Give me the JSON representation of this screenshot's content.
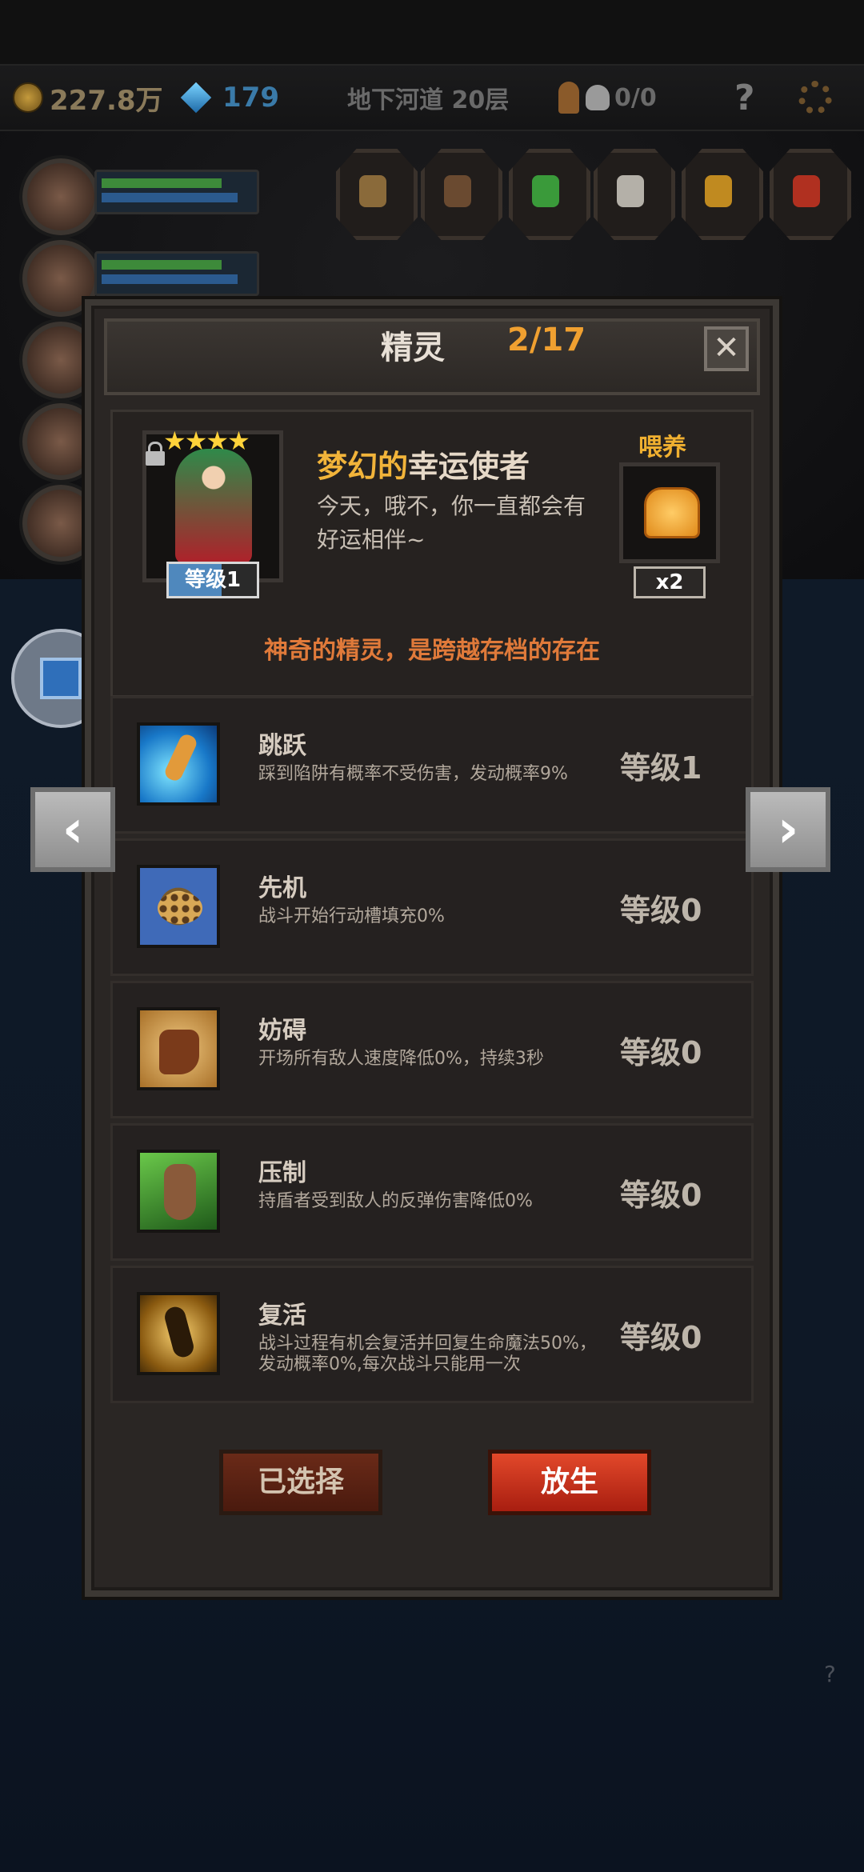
{
  "topbar": {
    "gold": "227.8万",
    "gems": "179",
    "location": "地下河道 20层",
    "keys": "0/0",
    "help": "?"
  },
  "dialog": {
    "title": "精灵",
    "count": "2/17",
    "close": "✕"
  },
  "spirit": {
    "stars": "★★★★",
    "level": "等级1",
    "name_quality": "梦幻的",
    "name": "幸运使者",
    "description": "今天，哦不，你一直都会有好运相伴~",
    "feed_label": "喂养",
    "feed_count": "x2",
    "tagline": "神奇的精灵，是跨越存档的存在"
  },
  "skills": [
    {
      "name": "跳跃",
      "desc": "踩到陷阱有概率不受伤害，发动概率9%",
      "level": "等级1",
      "icon": "jump-icon"
    },
    {
      "name": "先机",
      "desc": "战斗开始行动槽填充0%",
      "level": "等级0",
      "icon": "leopard-icon"
    },
    {
      "name": "妨碍",
      "desc": "开场所有敌人速度降低0%，持续3秒",
      "level": "等级0",
      "icon": "chained-boot-icon"
    },
    {
      "name": "压制",
      "desc": "持盾者受到敌人的反弹伤害降低0%",
      "level": "等级0",
      "icon": "claw-icon"
    },
    {
      "name": "复活",
      "desc": "战斗过程有机会复活并回复生命魔法50%，发动概率0%,每次战斗只能用一次",
      "level": "等级0",
      "icon": "revive-icon"
    }
  ],
  "buttons": {
    "selected": "已选择",
    "release": "放生"
  },
  "nav": {
    "prev": "‹",
    "next": "›"
  }
}
